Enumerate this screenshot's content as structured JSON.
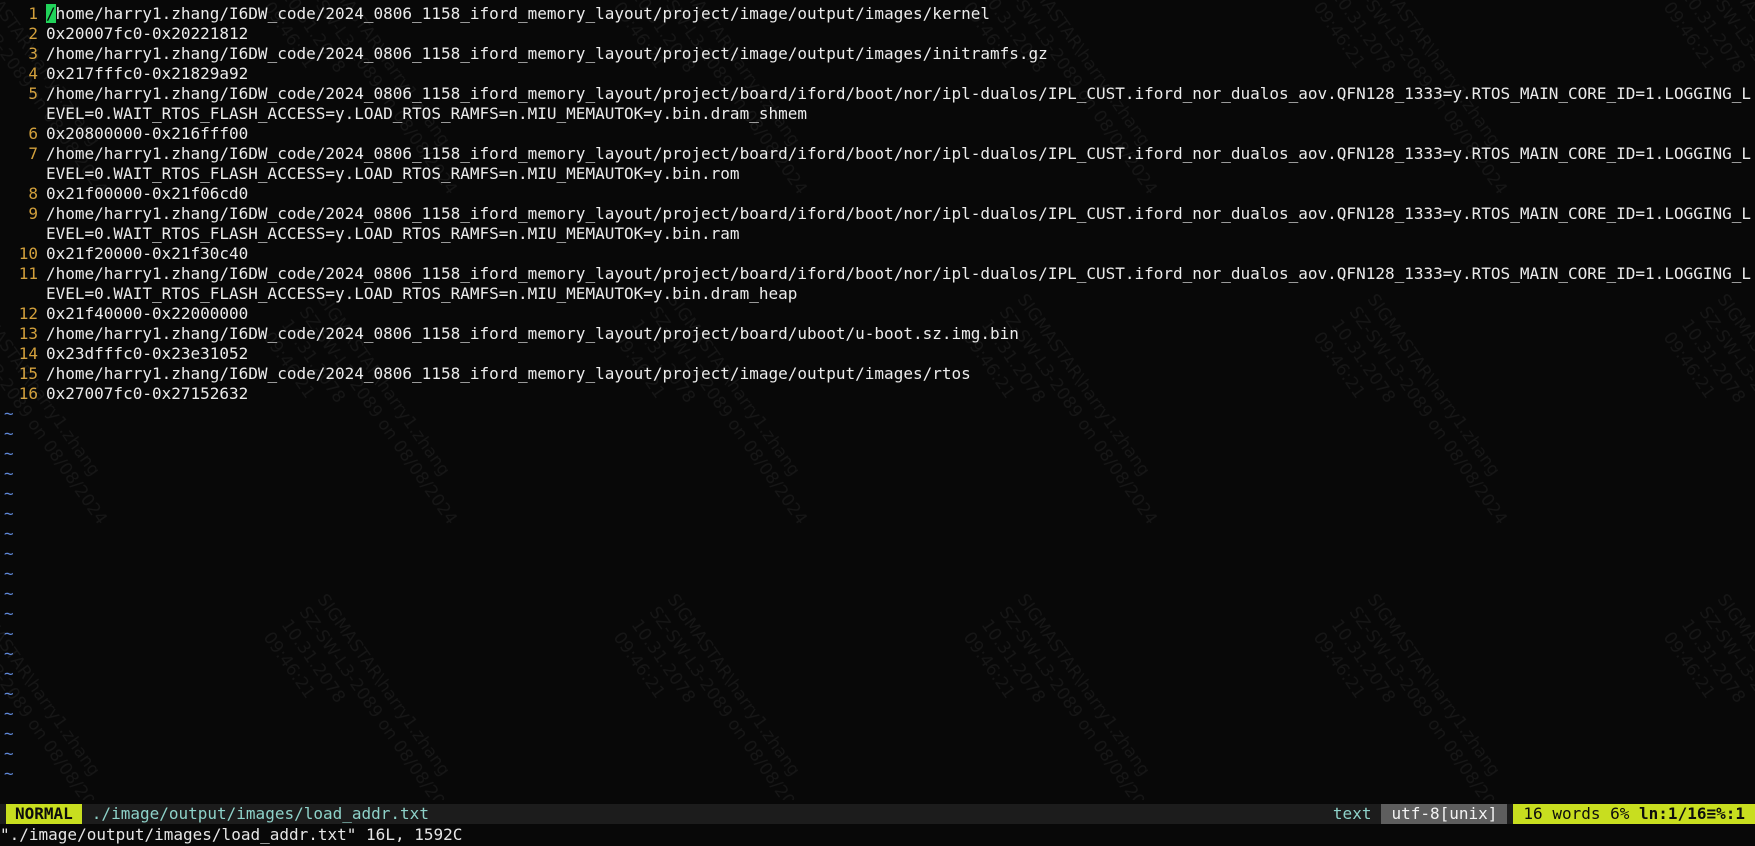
{
  "editor": {
    "lines": [
      {
        "n": "1",
        "text": "/home/harry1.zhang/I6DW_code/2024_0806_1158_iford_memory_layout/project/image/output/images/kernel"
      },
      {
        "n": "2",
        "text": "0x20007fc0-0x20221812"
      },
      {
        "n": "3",
        "text": "/home/harry1.zhang/I6DW_code/2024_0806_1158_iford_memory_layout/project/image/output/images/initramfs.gz"
      },
      {
        "n": "4",
        "text": "0x217fffc0-0x21829a92"
      },
      {
        "n": "5",
        "text": "/home/harry1.zhang/I6DW_code/2024_0806_1158_iford_memory_layout/project/board/iford/boot/nor/ipl-dualos/IPL_CUST.iford_nor_dualos_aov.QFN128_1333=y.RTOS_MAIN_CORE_ID=1.LOGGING_LEVEL=0.WAIT_RTOS_FLASH_ACCESS=y.LOAD_RTOS_RAMFS=n.MIU_MEMAUTOK=y.bin.dram_shmem"
      },
      {
        "n": "6",
        "text": "0x20800000-0x216fff00"
      },
      {
        "n": "7",
        "text": "/home/harry1.zhang/I6DW_code/2024_0806_1158_iford_memory_layout/project/board/iford/boot/nor/ipl-dualos/IPL_CUST.iford_nor_dualos_aov.QFN128_1333=y.RTOS_MAIN_CORE_ID=1.LOGGING_LEVEL=0.WAIT_RTOS_FLASH_ACCESS=y.LOAD_RTOS_RAMFS=n.MIU_MEMAUTOK=y.bin.rom"
      },
      {
        "n": "8",
        "text": "0x21f00000-0x21f06cd0"
      },
      {
        "n": "9",
        "text": "/home/harry1.zhang/I6DW_code/2024_0806_1158_iford_memory_layout/project/board/iford/boot/nor/ipl-dualos/IPL_CUST.iford_nor_dualos_aov.QFN128_1333=y.RTOS_MAIN_CORE_ID=1.LOGGING_LEVEL=0.WAIT_RTOS_FLASH_ACCESS=y.LOAD_RTOS_RAMFS=n.MIU_MEMAUTOK=y.bin.ram"
      },
      {
        "n": "10",
        "text": "0x21f20000-0x21f30c40"
      },
      {
        "n": "11",
        "text": "/home/harry1.zhang/I6DW_code/2024_0806_1158_iford_memory_layout/project/board/iford/boot/nor/ipl-dualos/IPL_CUST.iford_nor_dualos_aov.QFN128_1333=y.RTOS_MAIN_CORE_ID=1.LOGGING_LEVEL=0.WAIT_RTOS_FLASH_ACCESS=y.LOAD_RTOS_RAMFS=n.MIU_MEMAUTOK=y.bin.dram_heap"
      },
      {
        "n": "12",
        "text": "0x21f40000-0x22000000"
      },
      {
        "n": "13",
        "text": "/home/harry1.zhang/I6DW_code/2024_0806_1158_iford_memory_layout/project/board/uboot/u-boot.sz.img.bin"
      },
      {
        "n": "14",
        "text": "0x23dfffc0-0x23e31052"
      },
      {
        "n": "15",
        "text": "/home/harry1.zhang/I6DW_code/2024_0806_1158_iford_memory_layout/project/image/output/images/rtos"
      },
      {
        "n": "16",
        "text": "0x27007fc0-0x27152632"
      }
    ],
    "empty_line_marker": "~",
    "empty_line_count": 19
  },
  "statusline": {
    "mode": "NORMAL",
    "filename": "./image/output/images/load_addr.txt",
    "filetype": "text",
    "encoding": "utf-8[unix]",
    "words": "16 words",
    "percent": "6%",
    "position": "ln:1/16≡%:1"
  },
  "cmdline": {
    "message": "\"./image/output/images/load_addr.txt\" 16L, 1592C"
  },
  "watermark": {
    "lines": [
      "SIGMASTAR\\harry1.zhang",
      "SZ-SW-L3-2089 on 08/08/2024",
      "10.31.2078",
      "09:46:21"
    ]
  },
  "colors": {
    "background": "#080808",
    "line_number": "#d2a03c",
    "tilde": "#5f87d7",
    "mode_bg": "#c8de1f",
    "cursor": "#21d35a"
  }
}
